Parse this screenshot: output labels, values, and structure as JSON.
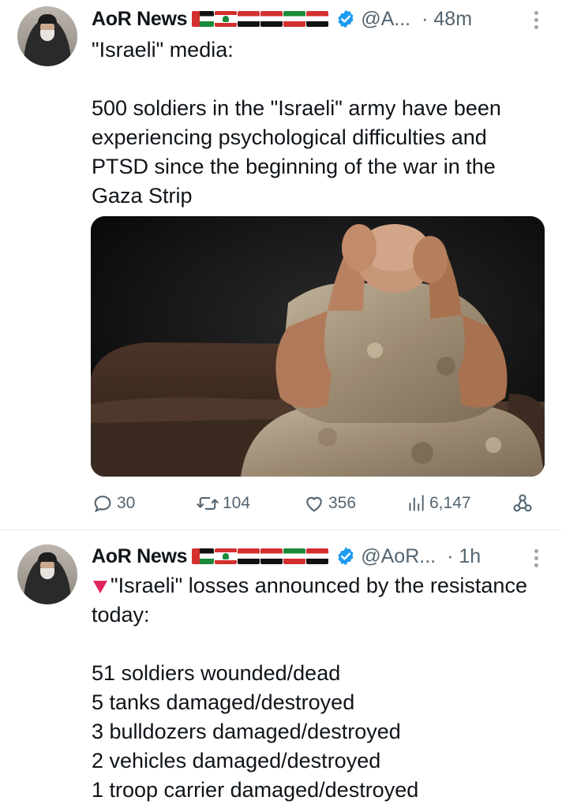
{
  "tweets": [
    {
      "author": "AoR News",
      "flag_icons": [
        "palestine-flag-icon",
        "lebanon-flag-icon",
        "syria-flag-icon",
        "iraq-flag-icon",
        "iran-flag-icon",
        "yemen-flag-icon"
      ],
      "verified_icon": "verified-badge-icon",
      "handle": "@A...",
      "time": "· 48m",
      "text_lines": [
        "\"Israeli\" media:",
        "",
        "500 soldiers in the \"Israeli\" army have been experiencing psychological difficulties and PTSD since the beginning of the war in the Gaza Strip"
      ],
      "media": "image-soldier-head-in-hands",
      "actions": {
        "replies": "30",
        "retweets": "104",
        "likes": "356",
        "views": "6,147"
      }
    },
    {
      "author": "AoR News",
      "flag_icons": [
        "palestine-flag-icon",
        "lebanon-flag-icon",
        "syria-flag-icon",
        "iraq-flag-icon",
        "iran-flag-icon",
        "yemen-flag-icon"
      ],
      "verified_icon": "verified-badge-icon",
      "handle": "@AoR...",
      "time": "· 1h",
      "lead_icon": "red-triangle-icon",
      "text_lines": [
        "\"Israeli\" losses announced by the resistance today:",
        "",
        "51 soldiers wounded/dead",
        "5 tanks damaged/destroyed",
        "3 bulldozers damaged/destroyed",
        "2 vehicles damaged/destroyed",
        "1 troop carrier damaged/destroyed"
      ]
    }
  ],
  "colors": {
    "verified": "#1d9bf0",
    "secondary_text": "#536471",
    "divider": "#e6ecf0",
    "red_triangle": "#e0245e"
  }
}
